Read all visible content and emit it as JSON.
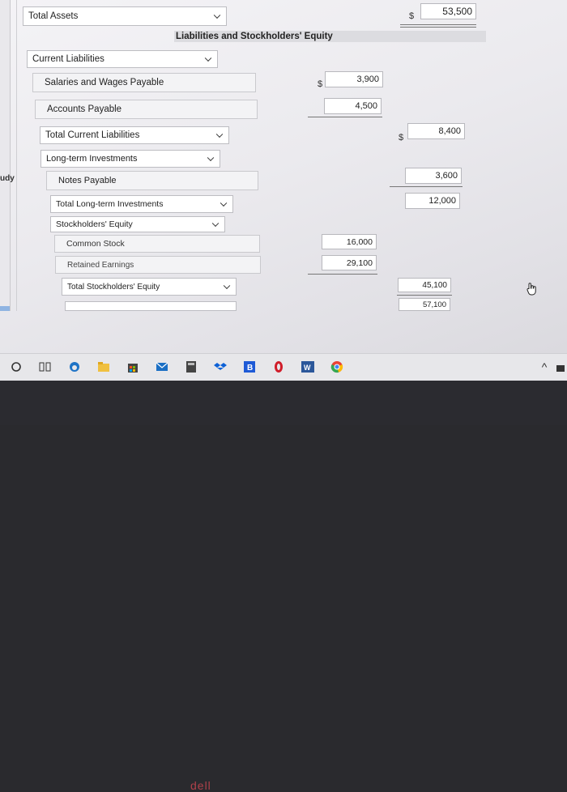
{
  "side_text": "udy",
  "total_assets": {
    "label": "Total Assets",
    "currency": "$",
    "value": "53,500"
  },
  "section_header": "Liabilities and Stockholders' Equity",
  "current_liabilities": {
    "label": "Current Liabilities",
    "items": [
      {
        "label": "Salaries and Wages Payable",
        "currency": "$",
        "value": "3,900"
      },
      {
        "label": "Accounts Payable",
        "value": "4,500"
      }
    ],
    "total_label": "Total Current Liabilities",
    "total_currency": "$",
    "total_value": "8,400"
  },
  "long_term": {
    "label": "Long-term Investments",
    "items": [
      {
        "label": "Notes Payable",
        "value": "3,600"
      }
    ],
    "total_label": "Total Long-term Investments",
    "total_value": "12,000"
  },
  "equity": {
    "label": "Stockholders' Equity",
    "items": [
      {
        "label": "Common Stock",
        "value": "16,000"
      },
      {
        "label": "Retained Earnings",
        "value": "29,100"
      }
    ],
    "total_label": "Total Stockholders' Equity",
    "total_value": "45,100"
  },
  "final_row": {
    "value": "57,100"
  },
  "brand_text": "dell",
  "taskbar": {
    "icons": [
      "cortana-circle-icon",
      "task-view-icon",
      "edge-icon",
      "file-explorer-icon",
      "store-icon",
      "mail-icon",
      "calculator-icon",
      "dropbox-icon",
      "bold-b-icon",
      "app-red-icon",
      "word-icon",
      "chrome-icon"
    ],
    "chevron": "^"
  }
}
